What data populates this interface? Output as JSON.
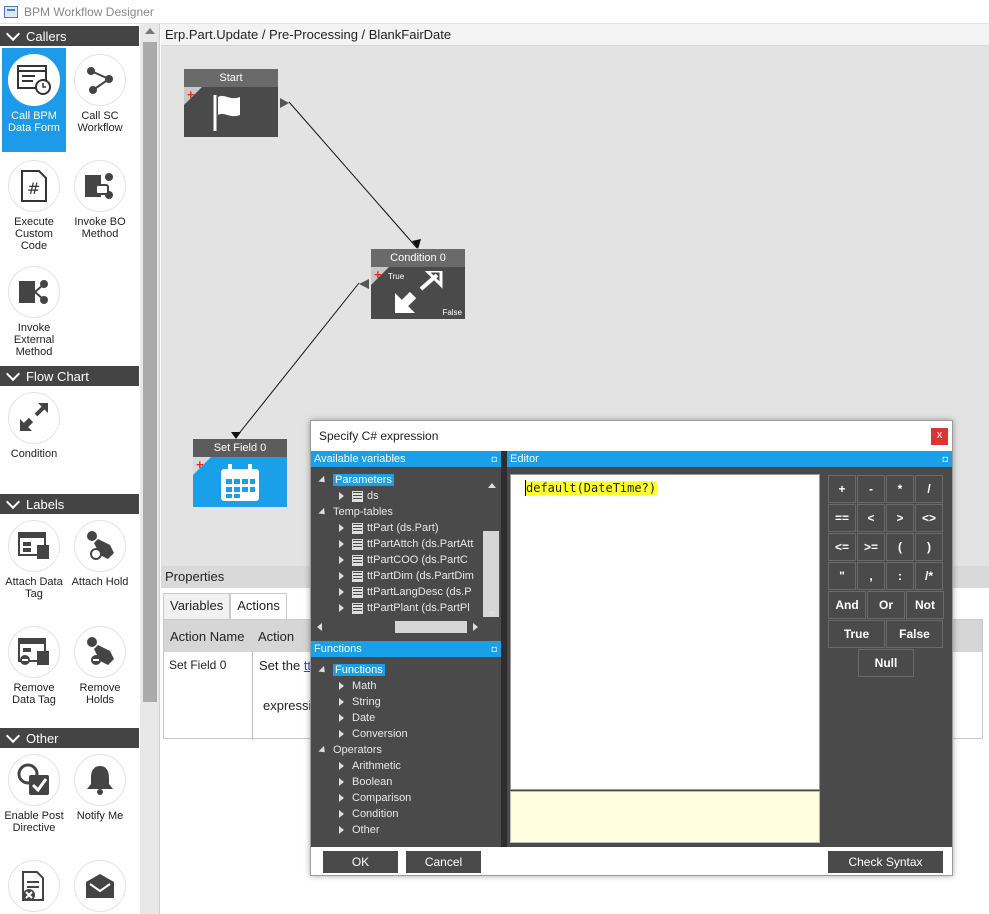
{
  "window": {
    "title": "BPM Workflow Designer"
  },
  "toolbox": {
    "sections": [
      {
        "label": "Callers"
      },
      {
        "label": "Flow Chart"
      },
      {
        "label": "Labels"
      },
      {
        "label": "Other"
      }
    ],
    "callers": [
      {
        "label": "Call BPM Data Form",
        "icon": "data-form-icon",
        "selected": true
      },
      {
        "label": "Call SC Workflow",
        "icon": "workflow-icon"
      },
      {
        "label": "Execute Custom Code",
        "icon": "code-icon"
      },
      {
        "label": "Invoke BO Method",
        "icon": "bo-method-icon"
      },
      {
        "label": "Invoke External Method",
        "icon": "external-method-icon"
      }
    ],
    "flowchart": [
      {
        "label": "Condition",
        "icon": "condition-icon"
      }
    ],
    "labels": [
      {
        "label": "Attach Data Tag",
        "icon": "data-tag-icon"
      },
      {
        "label": "Attach Hold",
        "icon": "hold-tag-icon"
      },
      {
        "label": "Remove Data Tag",
        "icon": "remove-data-tag-icon"
      },
      {
        "label": "Remove Holds",
        "icon": "remove-hold-icon"
      }
    ],
    "other": [
      {
        "label": "Enable Post Directive",
        "icon": "post-directive-icon"
      },
      {
        "label": "Notify Me",
        "icon": "bell-icon"
      }
    ]
  },
  "breadcrumb": "Erp.Part.Update / Pre-Processing / BlankFairDate",
  "nodes": {
    "start": {
      "label": "Start"
    },
    "condition": {
      "label": "Condition 0",
      "true_label": "True",
      "false_label": "False"
    },
    "setfield": {
      "label": "Set Field 0"
    }
  },
  "properties": {
    "header": "Properties",
    "tabs": [
      "Variables",
      "Actions"
    ],
    "columns": [
      "Action Name",
      "Action"
    ],
    "row": {
      "name": "Set Field 0",
      "action_prefix": "Set the ",
      "action_link": "tt",
      "action_suffix": "expressio"
    }
  },
  "dialog": {
    "title": "Specify C# expression",
    "close": "x",
    "variables_header": "Available variables",
    "variables": {
      "parameters": "Parameters",
      "ds": "ds",
      "temp_tables": "Temp-tables",
      "items": [
        "ttPart (ds.Part)",
        "ttPartAttch (ds.PartAtt",
        "ttPartCOO (ds.PartC",
        "ttPartDim (ds.PartDim",
        "ttPartLangDesc (ds.P",
        "ttPartPlant (ds.PartPl"
      ]
    },
    "functions_header": "Functions",
    "functions": {
      "root": "Functions",
      "items": [
        "Math",
        "String",
        "Date",
        "Conversion"
      ],
      "operators": "Operators",
      "operator_items": [
        "Arithmetic",
        "Boolean",
        "Comparison",
        "Condition",
        "Other"
      ]
    },
    "editor_header": "Editor",
    "editor_code": "default(DateTime?)",
    "operators": {
      "row1": [
        "+",
        "-",
        "*",
        "/"
      ],
      "row2": [
        "==",
        "<",
        ">",
        "<>"
      ],
      "row3": [
        "<=",
        ">=",
        "(",
        ")"
      ],
      "row4": [
        "\"",
        ",",
        ":",
        "/*"
      ],
      "row5": [
        "And",
        "Or",
        "Not"
      ],
      "row6": [
        "True",
        "False"
      ],
      "row7": [
        "Null"
      ]
    },
    "ok": "OK",
    "cancel": "Cancel",
    "check_syntax": "Check Syntax"
  }
}
